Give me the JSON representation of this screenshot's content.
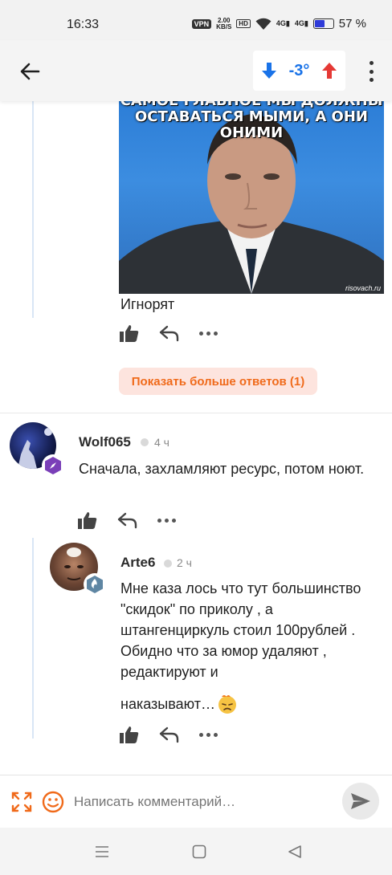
{
  "status_bar": {
    "time": "16:33",
    "vpn": "VPN",
    "speed_value": "2.00",
    "speed_unit": "KB/S",
    "hd": "HD",
    "signal_1": "4G",
    "signal_2": "4G",
    "battery_percent": "57 %",
    "battery_level": 0.57
  },
  "app_bar": {
    "karma_value": "-3°",
    "colors": {
      "down": "#1a73e8",
      "up": "#e53935"
    }
  },
  "reply_block": {
    "meme_caption_line1": "САМОЕ ГЛАВНОЕ МЫ ДОЛЖНЫ",
    "meme_caption_line2": "ОСТАВАТЬСЯ МЫМИ, А ОНИ ОНИМИ",
    "meme_watermark": "risovach.ru",
    "text": "Игнорят"
  },
  "show_more_label": "Показать больше ответов (1)",
  "comments": [
    {
      "author": "Wolf065",
      "time": "4 ч",
      "text": "Сначала, захламляют ресурс, потом ноют."
    },
    {
      "author": "Arte6",
      "time": "2 ч",
      "text": "Мне каза лось что тут большинство \"скидок\" по приколу , а штангенциркуль стоил 100рублей . Обидно что за юмор удаляют , редактируют и",
      "text_last": "наказывают…"
    }
  ],
  "composer": {
    "placeholder": "Написать комментарий…"
  },
  "accent": "#f06a1a"
}
